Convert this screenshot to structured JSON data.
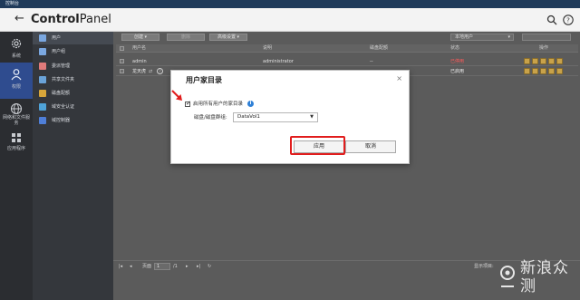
{
  "window": {
    "title": "控制台"
  },
  "header": {
    "back_glyph": "←",
    "title_bold": "Control",
    "title_rest": "Panel"
  },
  "iconbar": {
    "items": [
      {
        "label": "系统",
        "icon": "gear-icon",
        "active": false
      },
      {
        "label": "权限",
        "icon": "user-icon",
        "active": true
      },
      {
        "label": "网络和文件服务",
        "icon": "globe-icon",
        "active": false
      },
      {
        "label": "应用程序",
        "icon": "grid-icon",
        "active": false
      }
    ]
  },
  "sidebar": {
    "items": [
      {
        "label": "用户",
        "color": "#7aa7e0",
        "active": true
      },
      {
        "label": "用户组",
        "color": "#7aa7e0",
        "active": false
      },
      {
        "label": "委派管理",
        "color": "#e07a7a",
        "active": false
      },
      {
        "label": "共享文件夹",
        "color": "#6aa3d8",
        "active": false
      },
      {
        "label": "磁盘配额",
        "color": "#d8a63a",
        "active": false
      },
      {
        "label": "域安全认证",
        "color": "#4fa3d8",
        "active": false
      },
      {
        "label": "域控制器",
        "color": "#4f7fd8",
        "active": false
      }
    ]
  },
  "toolbar": {
    "create_label": "创建",
    "delete_label": "删除",
    "advanced_label": "高级设置",
    "filter_value": "本地用户",
    "search_value": ""
  },
  "table": {
    "headers": [
      "用户名",
      "说明",
      "磁盘配额",
      "状态",
      "操作"
    ],
    "rows": [
      {
        "username": "admin",
        "description": "administrator",
        "quota": "--",
        "status": "已停用",
        "status_color": "#ff5a5a"
      },
      {
        "username": "龙天虎",
        "description": "",
        "quota": "--",
        "status": "已启用",
        "status_color": "#f0f0f0"
      }
    ]
  },
  "pager": {
    "page_label": "页面",
    "page_value": "1",
    "total_label": "/1",
    "display_label": "显示项目:"
  },
  "dialog": {
    "title": "用户家目录",
    "checkbox_label": "启用所有用户的家目录",
    "checkbox_checked": true,
    "field_label": "磁盘/磁盘群组:",
    "select_value": "DataVol1",
    "apply_label": "应用",
    "cancel_label": "取消"
  },
  "watermark": {
    "text": "新浪众测"
  }
}
